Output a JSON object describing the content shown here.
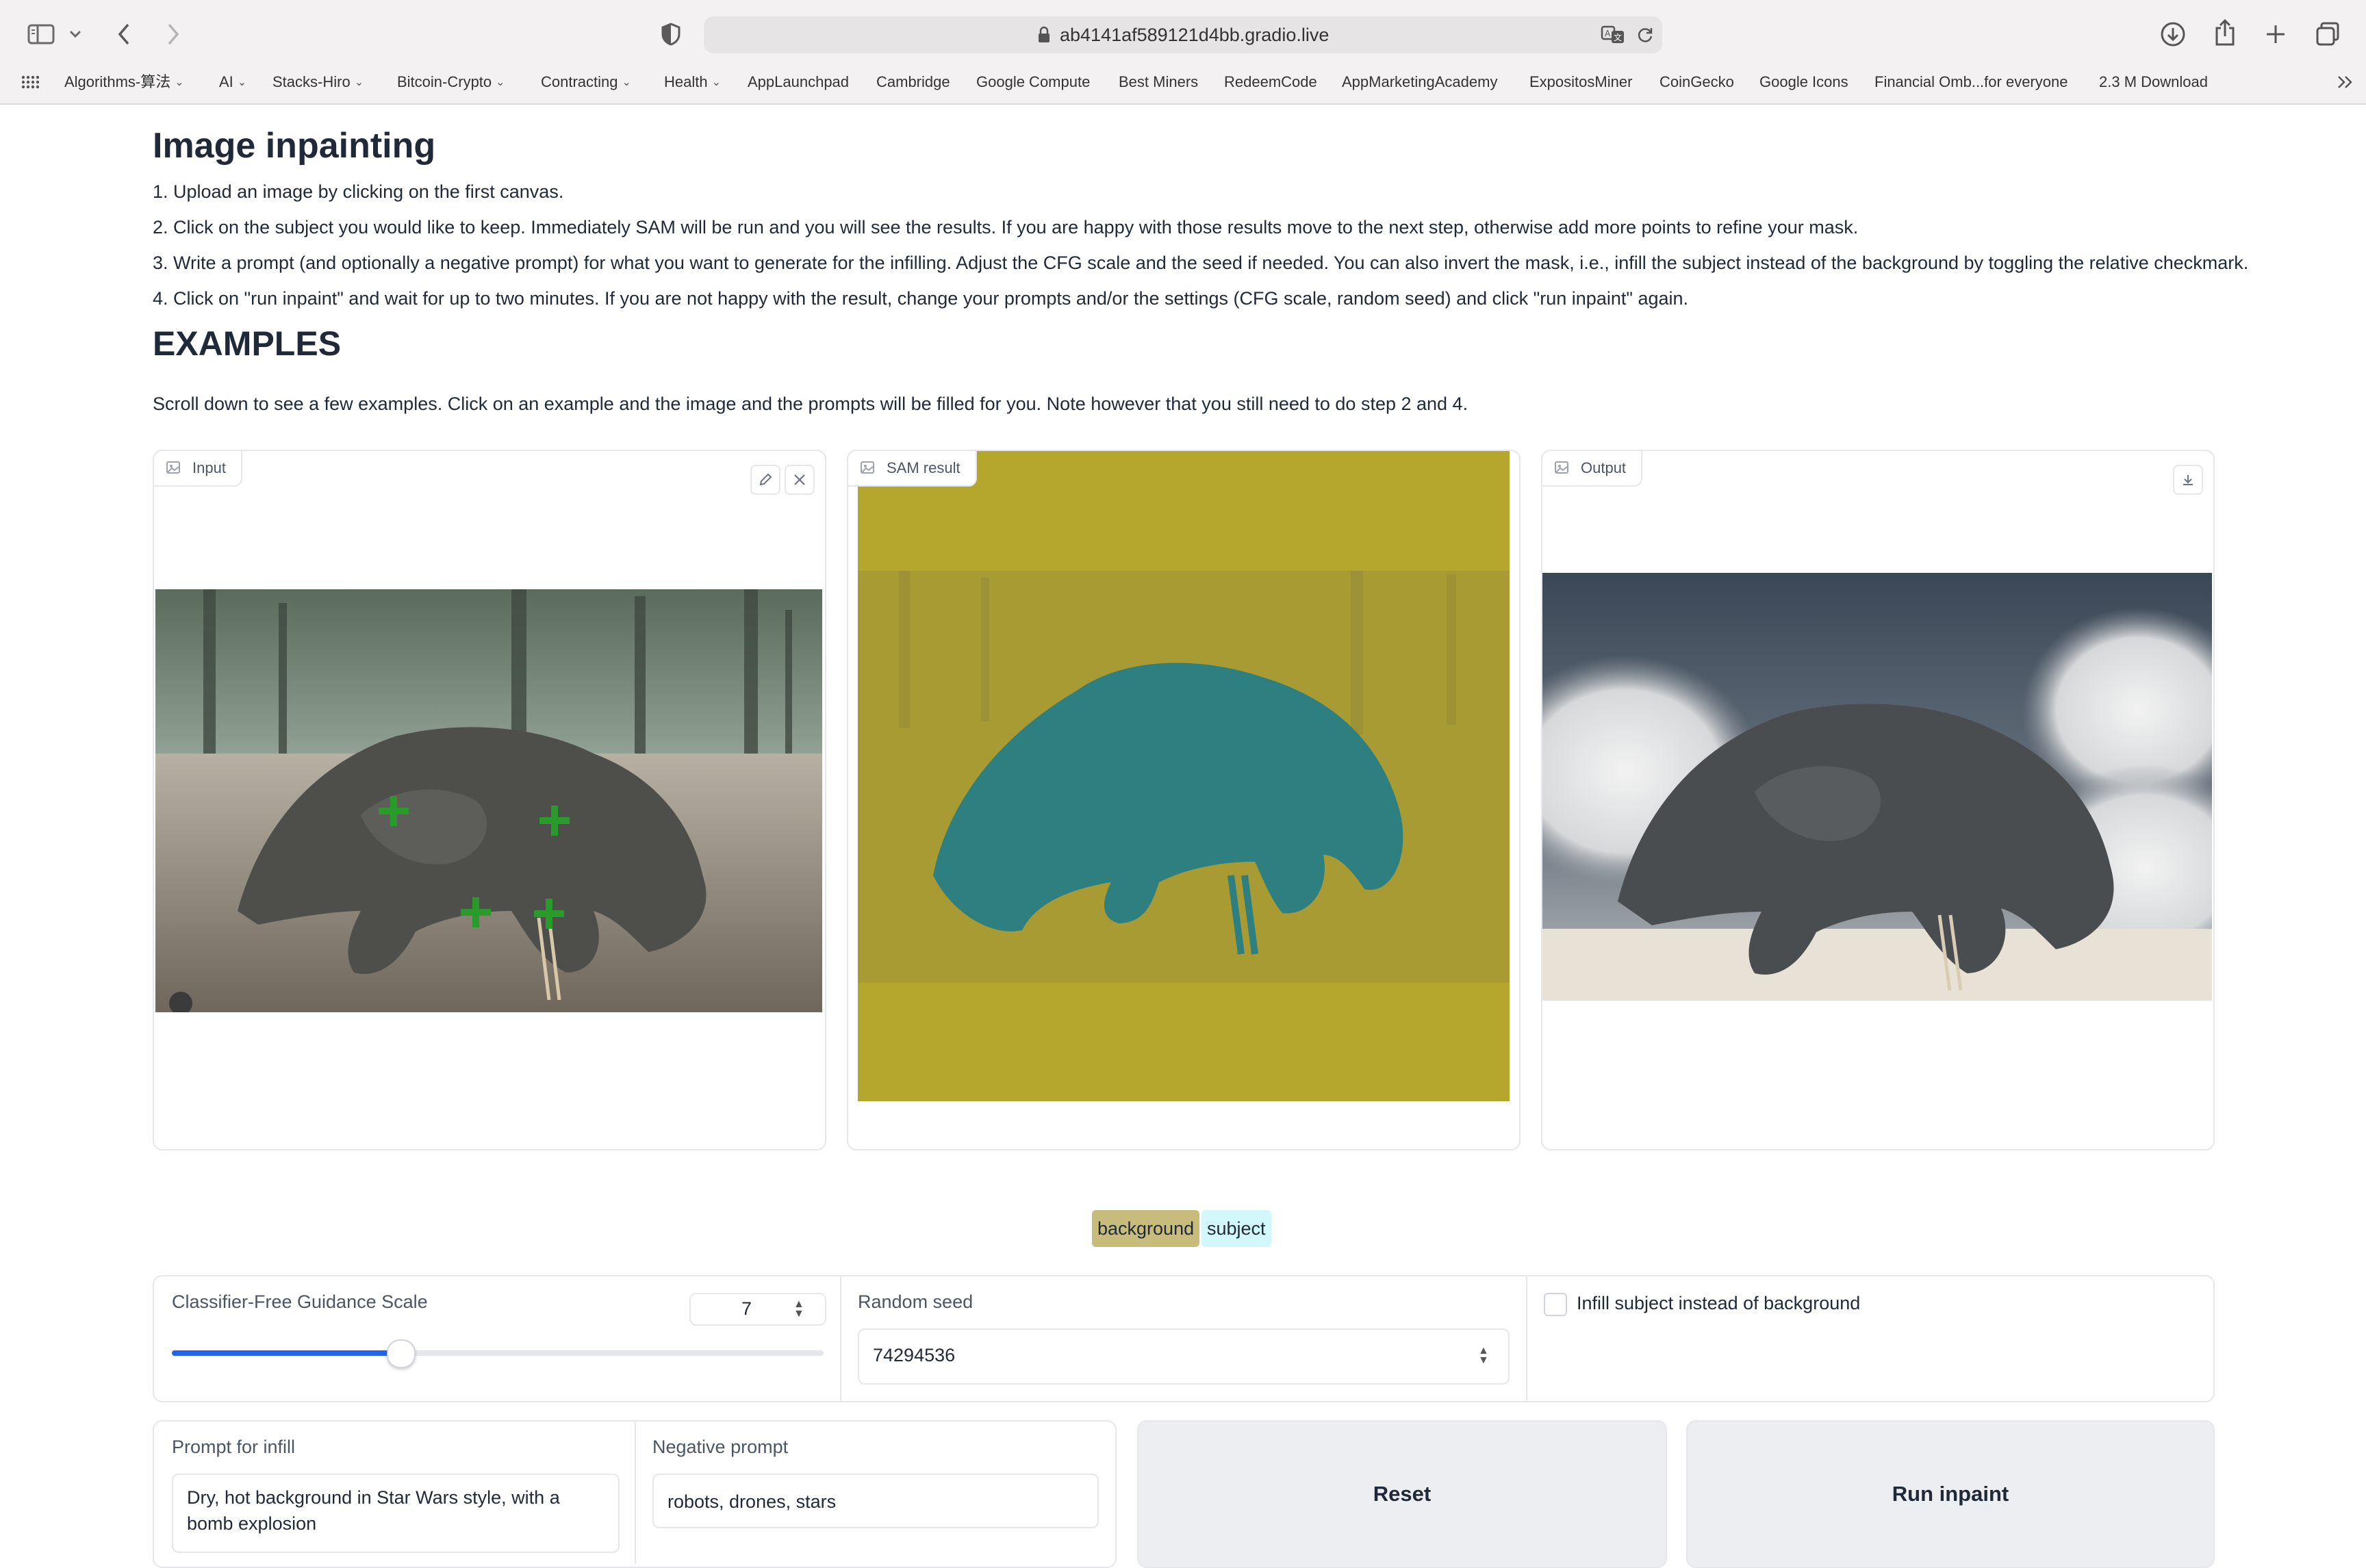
{
  "browser": {
    "url": "ab4141af589121d4bb.gradio.live",
    "bookmarks": [
      {
        "label": "Algorithms-算法",
        "chevron": true
      },
      {
        "label": "AI",
        "chevron": true
      },
      {
        "label": "Stacks-Hiro",
        "chevron": true
      },
      {
        "label": "Bitcoin-Crypto",
        "chevron": true
      },
      {
        "label": "Contracting",
        "chevron": true
      },
      {
        "label": "Health",
        "chevron": true
      },
      {
        "label": "AppLaunchpad",
        "chevron": false
      },
      {
        "label": "Cambridge",
        "chevron": false
      },
      {
        "label": "Google Compute",
        "chevron": false
      },
      {
        "label": "Best Miners",
        "chevron": false
      },
      {
        "label": "RedeemCode",
        "chevron": false
      },
      {
        "label": "AppMarketingAcademy",
        "chevron": false
      },
      {
        "label": "ExpositosMiner",
        "chevron": false
      },
      {
        "label": "CoinGecko",
        "chevron": false
      },
      {
        "label": "Google Icons",
        "chevron": false
      },
      {
        "label": "Financial Omb...for everyone",
        "chevron": false
      },
      {
        "label": "2.3 M Download",
        "chevron": false
      }
    ]
  },
  "page": {
    "title": "Image inpainting",
    "steps": [
      "1. Upload an image by clicking on the first canvas.",
      "2. Click on the subject you would like to keep. Immediately SAM will be run and you will see the results. If you are happy with those results move to the next step, otherwise add more points to refine your mask.",
      "3. Write a prompt (and optionally a negative prompt) for what you want to generate for the infilling. Adjust the CFG scale and the seed if needed. You can also invert the mask, i.e., infill the subject instead of the background by toggling the relative checkmark.",
      "4. Click on \"run inpaint\" and wait for up to two minutes. If you are not happy with the result, change your prompts and/or the settings (CFG scale, random seed) and click \"run inpaint\" again."
    ],
    "examples_heading": "EXAMPLES",
    "examples_text": "Scroll down to see a few examples. Click on an example and the image and the prompts will be filled for you. Note however that you still need to do step 2 and 4."
  },
  "panels": {
    "input_label": "Input",
    "sam_label": "SAM result",
    "output_label": "Output",
    "legend": [
      {
        "label": "background",
        "color": "#c7bc7b"
      },
      {
        "label": "subject",
        "color": "#d3f8fb"
      }
    ]
  },
  "controls": {
    "cfg_label": "Classifier-Free Guidance Scale",
    "cfg_value": "7",
    "cfg_fraction": 0.35,
    "seed_label": "Random seed",
    "seed_value": "74294536",
    "infill_label": "Infill subject instead of background",
    "infill_checked": false
  },
  "prompts": {
    "infill_label": "Prompt for infill",
    "infill_value": "Dry, hot background in Star Wars style, with a bomb explosion",
    "negative_label": "Negative prompt",
    "negative_value": "robots, drones, stars"
  },
  "buttons": {
    "reset": "Reset",
    "run": "Run inpaint"
  },
  "colors": {
    "accent": "#2563eb",
    "mask_background": "#b5a72e",
    "mask_subject": "#2e7f7f",
    "marker": "#2a9a2a"
  }
}
